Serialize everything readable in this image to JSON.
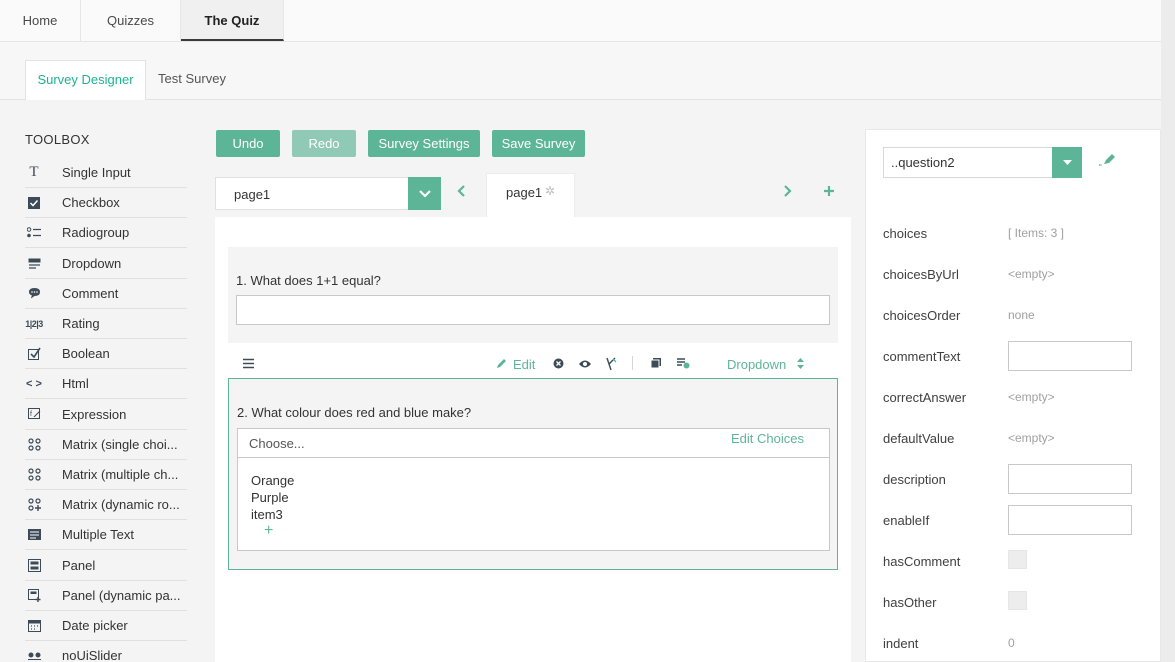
{
  "nav": {
    "tabs": [
      "Home",
      "Quizzes",
      "The Quiz"
    ]
  },
  "subnav": {
    "designer": "Survey Designer",
    "test": "Test Survey"
  },
  "toolbox": {
    "title": "TOOLBOX",
    "items": [
      {
        "label": "Single Input",
        "icon": "text-icon"
      },
      {
        "label": "Checkbox",
        "icon": "checkbox-icon"
      },
      {
        "label": "Radiogroup",
        "icon": "radiogroup-icon"
      },
      {
        "label": "Dropdown",
        "icon": "dropdown-icon"
      },
      {
        "label": "Comment",
        "icon": "comment-icon"
      },
      {
        "label": "Rating",
        "icon": "rating-icon"
      },
      {
        "label": "Boolean",
        "icon": "boolean-icon"
      },
      {
        "label": "Html",
        "icon": "html-icon"
      },
      {
        "label": "Expression",
        "icon": "expression-icon"
      },
      {
        "label": "Matrix (single choi...",
        "icon": "matrix-icon"
      },
      {
        "label": "Matrix (multiple ch...",
        "icon": "matrix-icon"
      },
      {
        "label": "Matrix (dynamic ro...",
        "icon": "matrix-dynamic-icon"
      },
      {
        "label": "Multiple Text",
        "icon": "multiple-text-icon"
      },
      {
        "label": "Panel",
        "icon": "panel-icon"
      },
      {
        "label": "Panel (dynamic pa...",
        "icon": "panel-dynamic-icon"
      },
      {
        "label": "Date picker",
        "icon": "date-picker-icon"
      },
      {
        "label": "noUiSlider",
        "icon": "slider-icon"
      }
    ]
  },
  "toolbar": {
    "undo": "Undo",
    "redo": "Redo",
    "settings": "Survey Settings",
    "save": "Save Survey"
  },
  "pages": {
    "selected": "page1",
    "tab": "page1"
  },
  "questions": {
    "q1": {
      "title": "1. What does 1+1 equal?"
    },
    "q2": {
      "title": "2. What colour does red and blue make?",
      "placeholder": "Choose...",
      "edit_choices": "Edit Choices",
      "choices": [
        "Orange",
        "Purple",
        "item3"
      ],
      "add": "+"
    }
  },
  "question_toolbar": {
    "edit": "Edit",
    "type": "Dropdown"
  },
  "properties": {
    "selected_question": "..question2",
    "rows": [
      {
        "name": "choices",
        "value": "[ Items: 3 ]",
        "kind": "text"
      },
      {
        "name": "choicesByUrl",
        "value": "<empty>",
        "kind": "text"
      },
      {
        "name": "choicesOrder",
        "value": "none",
        "kind": "text"
      },
      {
        "name": "commentText",
        "value": "",
        "kind": "input"
      },
      {
        "name": "correctAnswer",
        "value": "<empty>",
        "kind": "text"
      },
      {
        "name": "defaultValue",
        "value": "<empty>",
        "kind": "text"
      },
      {
        "name": "description",
        "value": "",
        "kind": "input"
      },
      {
        "name": "enableIf",
        "value": "",
        "kind": "input"
      },
      {
        "name": "hasComment",
        "value": "",
        "kind": "checkbox"
      },
      {
        "name": "hasOther",
        "value": "",
        "kind": "checkbox"
      },
      {
        "name": "indent",
        "value": "0",
        "kind": "text"
      }
    ]
  },
  "colors": {
    "accent": "#5db597",
    "accent_disabled": "#90c9b5"
  }
}
